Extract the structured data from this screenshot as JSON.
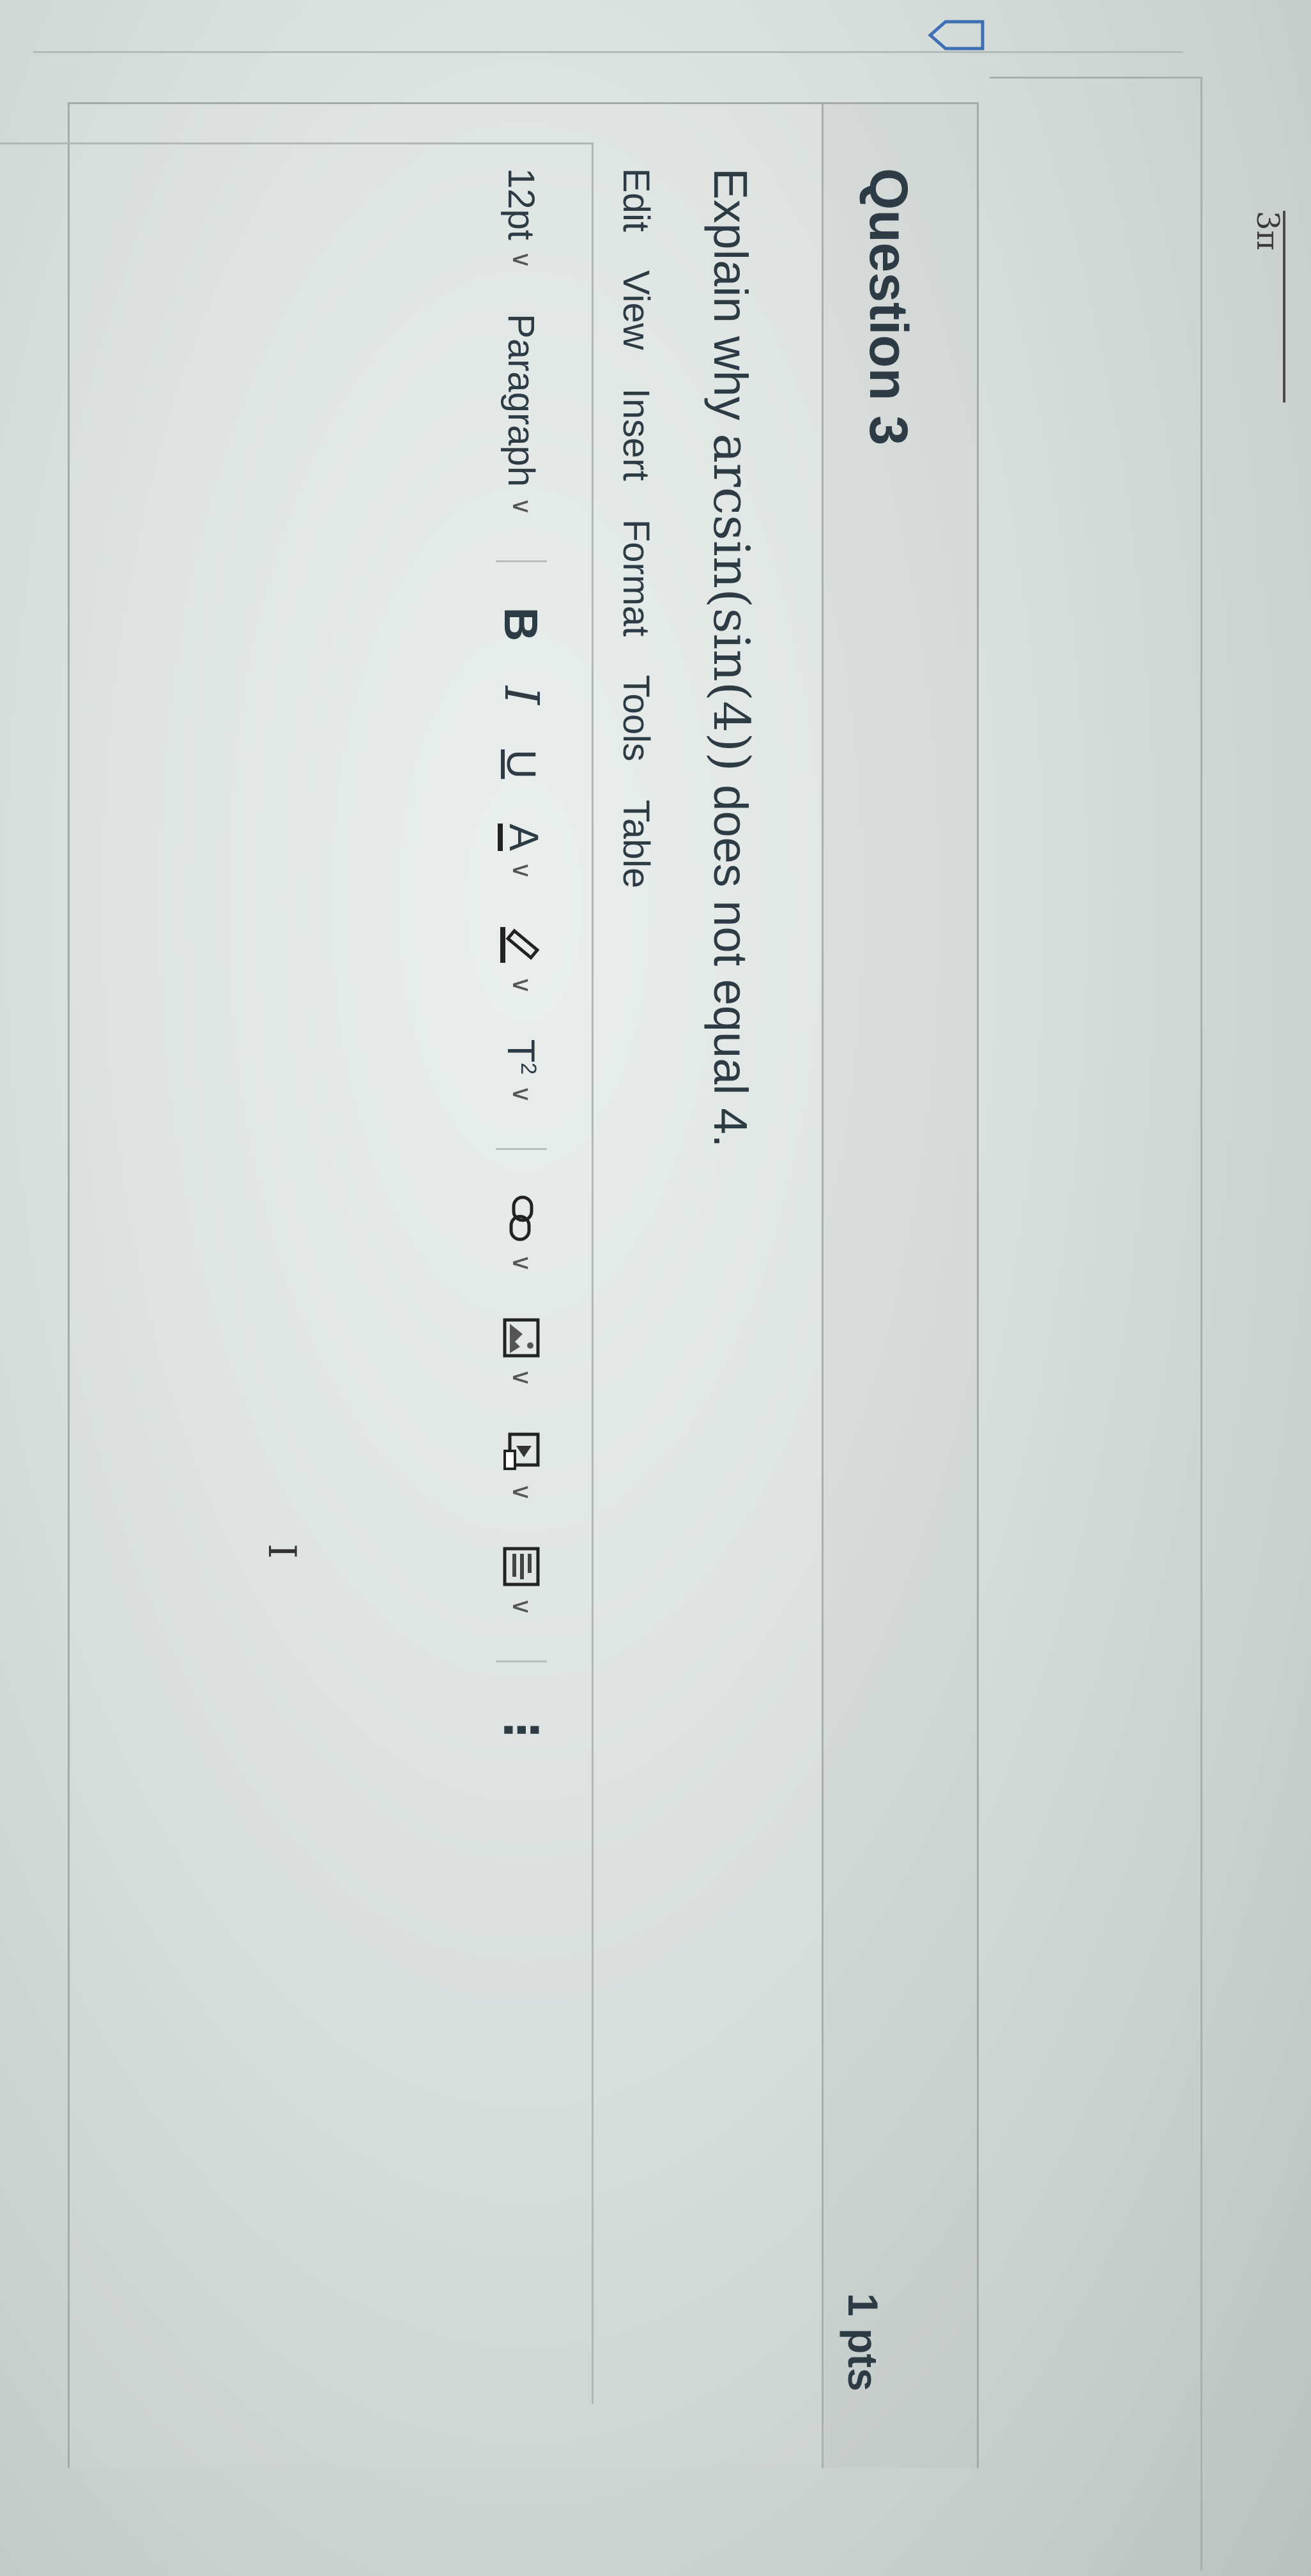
{
  "fragment": {
    "fraction_text": "3π"
  },
  "question": {
    "title": "Question 3",
    "points": "1 pts",
    "text_prefix": "Explain why ",
    "math_expression": "arcsin(sin(4))",
    "text_suffix": " does not equal 4."
  },
  "editor": {
    "menu": [
      "Edit",
      "View",
      "Insert",
      "Format",
      "Tools",
      "Table"
    ],
    "font_size": "12pt",
    "block_format": "Paragraph",
    "bold_label": "B",
    "italic_label": "I",
    "underline_label": "U",
    "text_color_label": "A",
    "superscript_label": "T",
    "superscript_mark": "2",
    "more_label": "⋮",
    "cursor_glyph": "I"
  },
  "icons": [
    "flag-icon",
    "chevron-down-icon",
    "bold-icon",
    "italic-icon",
    "underline-icon",
    "text-color-icon",
    "highlight-icon",
    "superscript-icon",
    "link-icon",
    "image-icon",
    "media-icon",
    "document-icon",
    "more-icon",
    "text-cursor-icon"
  ]
}
